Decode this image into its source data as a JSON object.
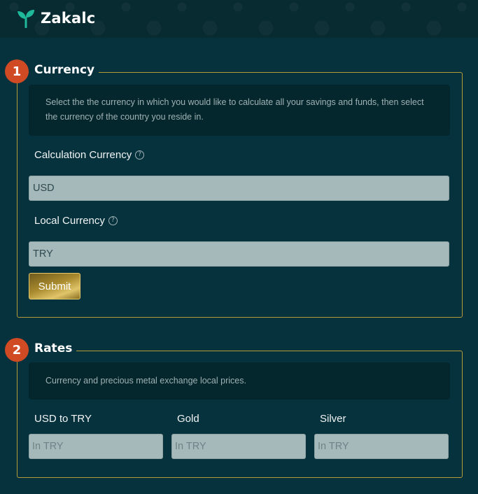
{
  "header": {
    "app_name": "Zakalc",
    "logo_icon": "sprout-icon",
    "accent_color": "#1fb89a"
  },
  "currency_section": {
    "step_number": "1",
    "title": "Currency",
    "description": "Select the the currency in which you would like to calculate all your savings and funds, then select the currency of the country you reside in.",
    "calculation_currency": {
      "label": "Calculation Currency",
      "help_icon": "question-circle-icon",
      "value": "USD"
    },
    "local_currency": {
      "label": "Local Currency",
      "help_icon": "question-circle-icon",
      "value": "TRY"
    },
    "submit_label": "Submit"
  },
  "rates_section": {
    "step_number": "2",
    "title": "Rates",
    "description": "Currency and precious metal exchange local prices.",
    "fields": [
      {
        "label": "USD to TRY",
        "placeholder": "In TRY"
      },
      {
        "label": "Gold",
        "placeholder": "In TRY"
      },
      {
        "label": "Silver",
        "placeholder": "In TRY"
      }
    ]
  },
  "colors": {
    "background": "#06323e",
    "badge": "#d04a23",
    "border": "#b59a3a",
    "input_bg": "#a6b9ba"
  }
}
